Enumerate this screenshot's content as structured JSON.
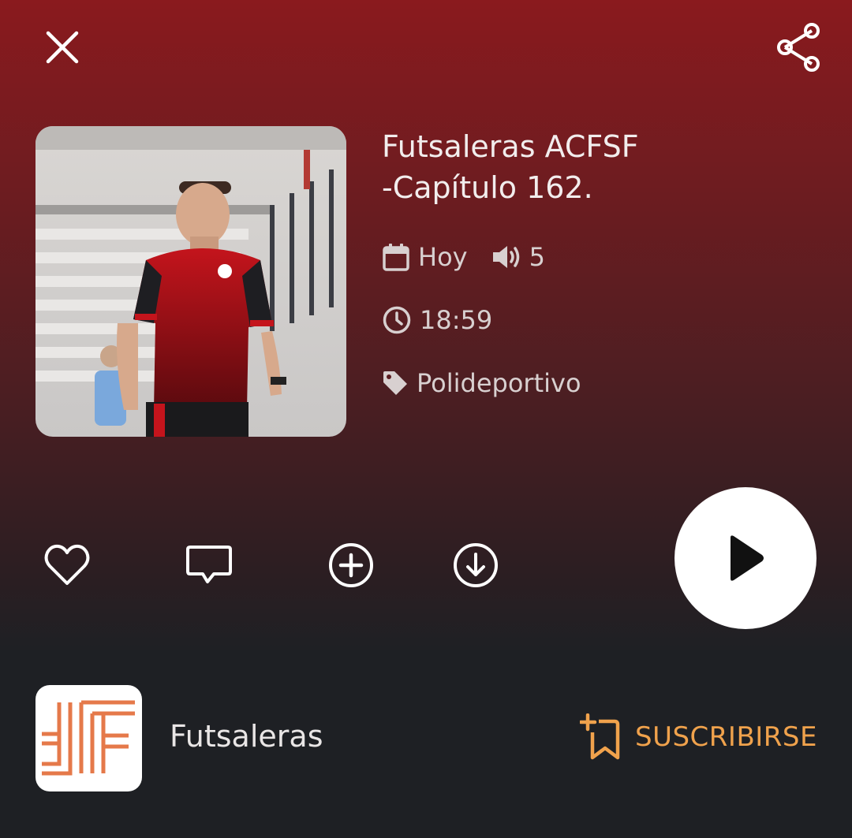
{
  "episode": {
    "title_line1": "Futsaleras ACFSF",
    "title_line2": "-Capítulo 162.",
    "date": "Hoy",
    "plays": "5",
    "duration": "18:59",
    "tag": "Polideportivo"
  },
  "icons": {
    "close": "close-icon",
    "share": "share-icon",
    "calendar": "calendar-icon",
    "speaker": "speaker-icon",
    "clock": "clock-icon",
    "tag": "tag-icon",
    "like": "heart-icon",
    "comment": "comment-icon",
    "add": "plus-circle-icon",
    "download": "download-icon",
    "play": "play-icon",
    "subscribe": "bookmark-add-icon"
  },
  "program": {
    "name": "Futsaleras",
    "subscribe_label": "SUSCRIBIRSE"
  },
  "colors": {
    "accent": "#f0a24c",
    "background_top": "#8a1a1e",
    "background_bottom": "#1e2024"
  }
}
